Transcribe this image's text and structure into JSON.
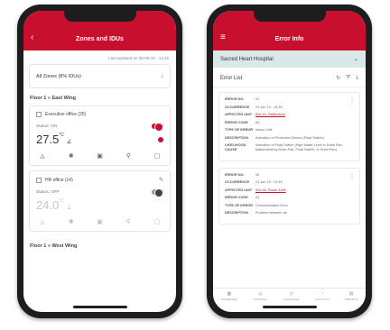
{
  "left_phone": {
    "header": {
      "back_icon": "chevron-left-icon",
      "title": "Zones and IDUs"
    },
    "last_updated": "Last updated on 28-09-18 · 14:45",
    "all_zones": {
      "label": "All Zones (8% IDUs)"
    },
    "section_1": "Floor 1 » East Wing",
    "zone_1": {
      "name": "Executive office (25)",
      "status": "Status: ON",
      "temperature": "27.5",
      "unit": "°C",
      "on": true
    },
    "zone_2": {
      "name": "HR office (14)",
      "status": "Status: OFF",
      "temperature": "24.0",
      "unit": "°C",
      "on": false
    },
    "section_2": "Floor 1 » West Wing",
    "colors": {
      "brand": "#c8102e"
    }
  },
  "right_phone": {
    "header": {
      "menu_icon": "menu-icon",
      "title": "Error Info"
    },
    "hospital": "Sacred Heart Hospital",
    "list_title": "Error List",
    "errors": [
      {
        "rows": [
          {
            "k": "ERROR NO.",
            "v": "01"
          },
          {
            "k": "OCCURRENCE",
            "v": "21 Jun 19 · 14:30"
          },
          {
            "k": "AFFECTED UNIT",
            "v": "IDU-01, Reflections"
          },
          {
            "k": "ERROR CODE",
            "v": "A4"
          },
          {
            "k": "TYPE OF ERROR",
            "v": "Indoor Unit"
          },
          {
            "k": "DESCRIPTION",
            "v": "Activation of Protection Device (Float Switch)"
          },
          {
            "k": "LIKELIHOOD CAUSE",
            "v": "Activation of Float Switch (High Water Level in Drain Pan, Malfunctioning Drain Pan, Float Switch, or Drain Pan)"
          }
        ]
      },
      {
        "rows": [
          {
            "k": "ERROR NO.",
            "v": "02"
          },
          {
            "k": "OCCURRENCE",
            "v": "21 Jun 19 · 14:48"
          },
          {
            "k": "AFFECTED UNIT",
            "v": "IDU-02, Room 1106"
          },
          {
            "k": "ERROR CODE",
            "v": "A1"
          },
          {
            "k": "TYPE OF ERROR",
            "v": "Communication Error"
          },
          {
            "k": "DESCRIPTION",
            "v": "Problem between air"
          }
        ]
      }
    ],
    "tabs": [
      {
        "icon": "dashboard-icon",
        "label": "DASHBOARD"
      },
      {
        "icon": "controls-icon",
        "label": "CONTROLS"
      },
      {
        "icon": "schedules-icon",
        "label": "SCHEDULES"
      },
      {
        "icon": "analytics-icon",
        "label": "ANALYTICS"
      },
      {
        "icon": "reports-icon",
        "label": "REPORTS"
      }
    ]
  }
}
